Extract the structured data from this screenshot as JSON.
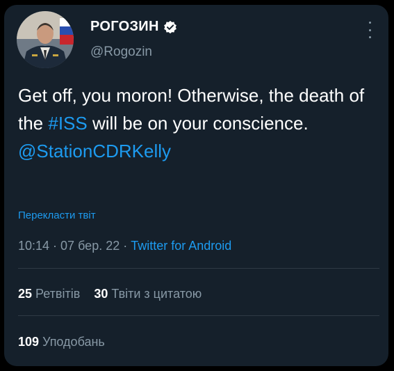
{
  "author": {
    "display_name": "РОГОЗИН",
    "handle": "@Rogozin"
  },
  "tweet": {
    "text_part1": "Get off, you moron!  Otherwise, the death of the ",
    "hashtag": "#ISS",
    "text_part2": " will be on your conscience.",
    "mention": "@StationCDRKelly"
  },
  "translate_label": "Перекласти твіт",
  "meta": {
    "time": "10:14",
    "separator": " · ",
    "date": "07 бер. 22",
    "source": "Twitter for Android"
  },
  "stats": {
    "retweets_count": "25",
    "retweets_label": "Ретвітів",
    "quotes_count": "30",
    "quotes_label": "Твіти з цитатою",
    "likes_count": "109",
    "likes_label": "Уподобань"
  },
  "colors": {
    "background": "#15202b",
    "link": "#1d9bf0",
    "secondary_text": "#8899a6"
  },
  "icons": {
    "verified": "verified-badge-icon",
    "more": "more-vertical-icon"
  }
}
